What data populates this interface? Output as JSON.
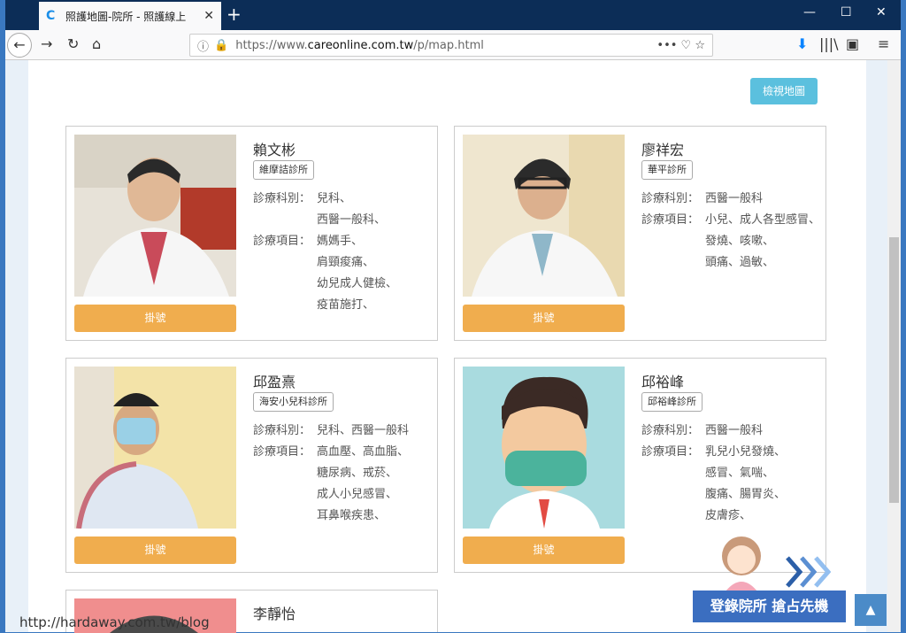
{
  "browser": {
    "tab_title": "照護地圖-院所 - 照護線上",
    "favicon": "C",
    "url_prefix": "https://www.",
    "url_host": "careonline.com.tw",
    "url_path": "/p/map.html"
  },
  "page": {
    "map_button": "檢視地圖",
    "book_label": "掛號",
    "label_specialty": "診療科別：",
    "label_items": "診療項目：",
    "banner": "登錄院所  搶占先機",
    "watermark": "http://hardaway.com.tw/blog"
  },
  "doctors": [
    {
      "name": "賴文彬",
      "clinic": "維摩詰診所",
      "specialty": "兒科、\n西醫一般科、",
      "items": "媽媽手、\n肩頸痠痛、\n幼兒成人健檢、\n疫苗施打、"
    },
    {
      "name": "廖祥宏",
      "clinic": "華平診所",
      "specialty": "西醫一般科",
      "items": "小兒、成人各型感冒、\n發燒、咳嗽、\n頭痛、過敏、"
    },
    {
      "name": "邱盈熹",
      "clinic": "海安小兒科診所",
      "specialty": "兒科、西醫一般科",
      "items": "高血壓、高血脂、\n糖尿病、戒菸、\n成人小兒感冒、\n耳鼻喉疾患、"
    },
    {
      "name": "邱裕峰",
      "clinic": "邱裕峰診所",
      "specialty": "西醫一般科",
      "items": "乳兒小兒發燒、\n感冒、氣喘、\n腹痛、腸胃炎、\n皮膚疹、"
    },
    {
      "name": "李靜怡"
    }
  ],
  "colors": {
    "book": "#f0ad4e",
    "map_button": "#5bc0de",
    "banner": "#3b6ec0"
  }
}
